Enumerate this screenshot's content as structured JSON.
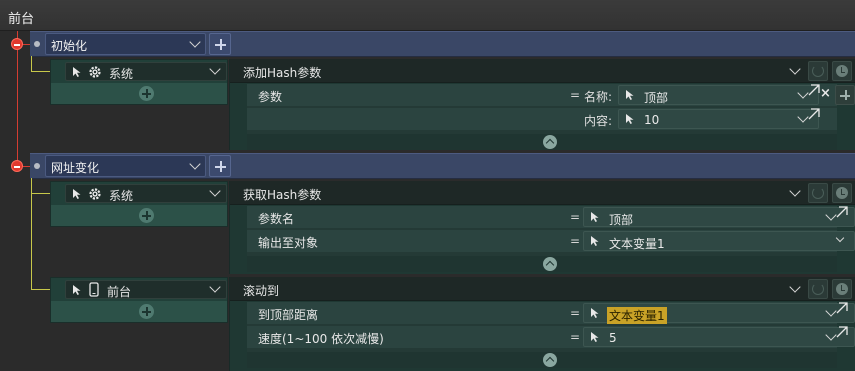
{
  "window": {
    "title": "前台"
  },
  "events": [
    {
      "label": "初始化",
      "trigger": {
        "label": "系统",
        "icon": "gear-icon"
      },
      "action": {
        "name": "添加Hash参数",
        "params": [
          {
            "label": "参数",
            "sub_label": "名称:",
            "value": "顶部"
          },
          {
            "label": "",
            "sub_label": "内容:",
            "value": "10"
          }
        ]
      }
    },
    {
      "label": "网址变化",
      "trigger": {
        "label": "系统",
        "icon": "gear-icon"
      },
      "action": {
        "name": "获取Hash参数",
        "params": [
          {
            "label": "参数名",
            "value": "顶部"
          },
          {
            "label": "输出至对象",
            "value": "文本变量1"
          }
        ]
      },
      "trigger2": {
        "label": "前台",
        "icon": "phone-icon"
      },
      "action2": {
        "name": "滚动到",
        "params": [
          {
            "label": "到顶部距离",
            "value": "文本变量1"
          },
          {
            "label": "速度(1~100 依次减慢)",
            "value": "5"
          }
        ]
      }
    }
  ],
  "symbols": {
    "equals": "=",
    "remove": "×"
  }
}
